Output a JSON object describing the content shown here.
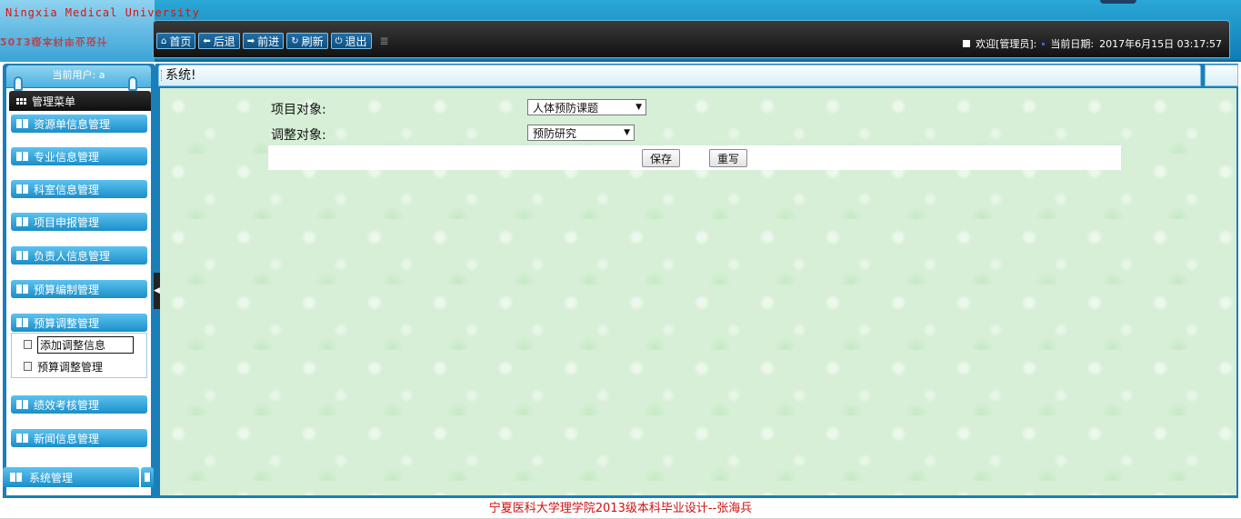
{
  "header": {
    "university_name": "Ningxia Medical University",
    "subtitle": "2013级本科毕业设计",
    "nav": [
      {
        "label": "首页",
        "icon": "home-icon",
        "glyph": "⌂"
      },
      {
        "label": "后退",
        "icon": "arrow-left-icon",
        "glyph": "⬅"
      },
      {
        "label": "前进",
        "icon": "arrow-right-icon",
        "glyph": "➡"
      },
      {
        "label": "刷新",
        "icon": "refresh-icon",
        "glyph": "↻"
      },
      {
        "label": "退出",
        "icon": "power-icon",
        "glyph": "⏻"
      }
    ],
    "welcome": "欢迎[管理员]:",
    "date_label": "当前日期:",
    "date_value": "2017年6月15日 03:17:57"
  },
  "sidebar": {
    "current_user": "当前用户: a",
    "menu_title": "管理菜单",
    "groups": [
      "资源单信息管理",
      "专业信息管理",
      "科室信息管理",
      "项目申报管理",
      "负责人信息管理",
      "预算编制管理",
      "预算调整管理",
      "绩效考核管理",
      "新闻信息管理"
    ],
    "subitems": [
      "添加调整信息",
      "预算调整管理"
    ],
    "system_menu": "系统管理"
  },
  "breadcrumb": "系统!",
  "form": {
    "project_label": "项目对象:",
    "project_value": "人体预防课题",
    "adjust_label": "调整对象:",
    "adjust_value": "预防研究",
    "save_label": "保存",
    "reset_label": "重写"
  },
  "footer": "宁夏医科大学理学院2013级本科毕业设计--张海兵",
  "colors": {
    "header_blue": "#1a8ec9",
    "brand_red": "#e01010",
    "footer_red": "#cc1111",
    "content_green": "#d6efd6"
  }
}
